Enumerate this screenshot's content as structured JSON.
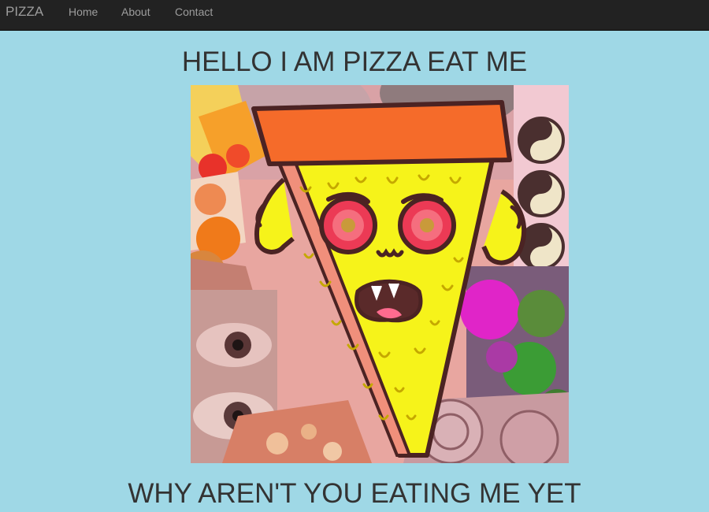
{
  "navbar": {
    "brand": "PIZZA",
    "links": [
      "Home",
      "About",
      "Contact"
    ]
  },
  "main": {
    "heading": "HELLO I AM PIZZA EAT ME",
    "image_alt": "cartoon pizza slice illustration",
    "subheading": "WHY AREN'T YOU EATING ME YET"
  },
  "colors": {
    "page_background": "#9fd8e6",
    "navbar_background": "#222222",
    "nav_text": "#9d9d9d",
    "heading_text": "#333333"
  }
}
